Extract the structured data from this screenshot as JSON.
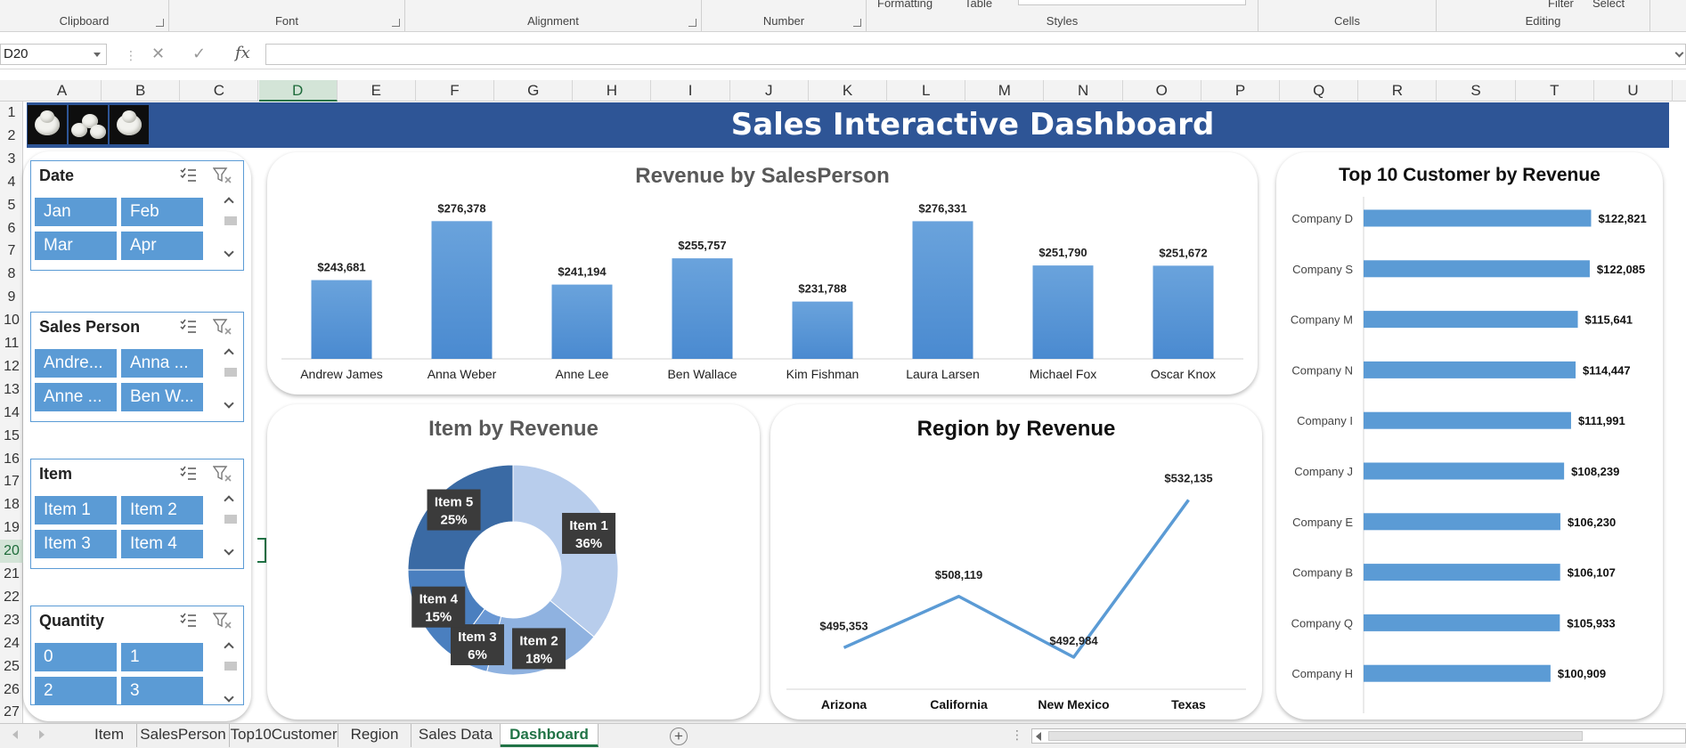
{
  "ribbon": {
    "groups": [
      "Clipboard",
      "Font",
      "Alignment",
      "Number",
      "Styles",
      "Cells",
      "Editing"
    ],
    "cut_labels": {
      "formatting": "Formatting",
      "table": "Table",
      "filter": "Filter",
      "select": "Select"
    }
  },
  "formula_bar": {
    "name_box": "D20",
    "fx": "fx",
    "formula": ""
  },
  "columns": [
    "A",
    "B",
    "C",
    "D",
    "E",
    "F",
    "G",
    "H",
    "I",
    "J",
    "K",
    "L",
    "M",
    "N",
    "O",
    "P",
    "Q",
    "R",
    "S",
    "T",
    "U"
  ],
  "rows": [
    "1",
    "2",
    "3",
    "4",
    "5",
    "6",
    "7",
    "8",
    "9",
    "10",
    "11",
    "12",
    "13",
    "14",
    "15",
    "16",
    "17",
    "18",
    "19",
    "20",
    "21",
    "22",
    "23",
    "24",
    "25",
    "26",
    "27"
  ],
  "selected": {
    "column": "D",
    "row": "20"
  },
  "dashboard": {
    "title": "Sales Interactive Dashboard"
  },
  "slicers": [
    {
      "title": "Date",
      "items": [
        "Jan",
        "Feb",
        "Mar",
        "Apr"
      ]
    },
    {
      "title": "Sales Person",
      "items": [
        "Andre...",
        "Anna ...",
        "Anne ...",
        "Ben W..."
      ]
    },
    {
      "title": "Item",
      "items": [
        "Item 1",
        "Item 2",
        "Item 3",
        "Item 4"
      ]
    },
    {
      "title": "Quantity",
      "items": [
        "0",
        "1",
        "2",
        "3"
      ]
    }
  ],
  "colors": {
    "bar": "#5b9bd5",
    "banner": "#2e5596",
    "accent": "#217346"
  },
  "chart_data": [
    {
      "type": "bar",
      "title": "Revenue by SalesPerson",
      "categories": [
        "Andrew James",
        "Anna Weber",
        "Anne Lee",
        "Ben Wallace",
        "Kim Fishman",
        "Laura Larsen",
        "Michael Fox",
        "Oscar Knox"
      ],
      "values": [
        243681,
        276378,
        241194,
        255757,
        231788,
        276331,
        251790,
        251672
      ],
      "labels": [
        "$243,681",
        "$276,378",
        "$241,194",
        "$255,757",
        "$231,788",
        "$276,331",
        "$251,790",
        "$251,672"
      ],
      "ylim": [
        200000,
        280000
      ],
      "grid": false
    },
    {
      "type": "pie",
      "title": "Item by Revenue",
      "categories": [
        "Item 1",
        "Item 2",
        "Item 3",
        "Item 4",
        "Item 5"
      ],
      "values": [
        36,
        18,
        6,
        15,
        25
      ],
      "labels": [
        "36%",
        "18%",
        "6%",
        "15%",
        "25%"
      ],
      "donut": true
    },
    {
      "type": "line",
      "title": "Region by Revenue",
      "categories": [
        "Arizona",
        "California",
        "New Mexico",
        "Texas"
      ],
      "values": [
        495353,
        508119,
        492984,
        532135
      ],
      "labels": [
        "$495,353",
        "$508,119",
        "$492,984",
        "$532,135"
      ],
      "grid": false
    },
    {
      "type": "bar",
      "orientation": "horizontal",
      "title": "Top 10 Customer by Revenue",
      "categories": [
        "Company D",
        "Company S",
        "Company M",
        "Company N",
        "Company I",
        "Company J",
        "Company E",
        "Company B",
        "Company Q",
        "Company H"
      ],
      "values": [
        122821,
        122085,
        115641,
        114447,
        111991,
        108239,
        106230,
        106107,
        105933,
        100909
      ],
      "labels": [
        "$122,821",
        "$122,085",
        "$115,641",
        "$114,447",
        "$111,991",
        "$108,239",
        "$106,230",
        "$106,107",
        "$105,933",
        "$100,909"
      ],
      "xlim": [
        0,
        125000
      ]
    }
  ],
  "sheet_tabs": [
    "Item",
    "SalesPerson",
    "Top10Customer",
    "Region",
    "Sales Data",
    "Dashboard"
  ],
  "active_tab": "Dashboard"
}
